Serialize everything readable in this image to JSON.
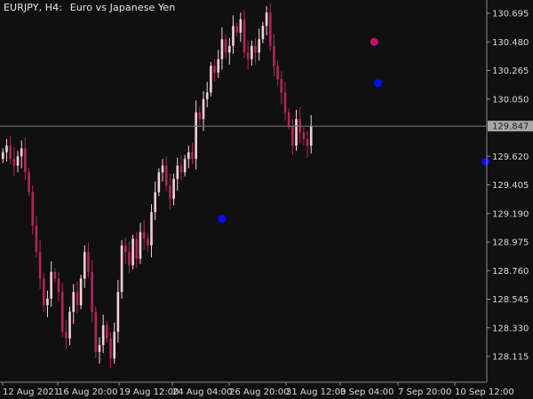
{
  "header": {
    "symbol_timeframe": "EURJPY, H4:",
    "description": "Euro vs Japanese Yen"
  },
  "colors": {
    "background": "#101010",
    "bull_candle": "#f6cfd6",
    "bear_candle": "#b0255e",
    "axis": "#8c8c8c",
    "axis_text": "#d9d9d9",
    "current_price_line": "#7a7a7a",
    "current_price_label_bg": "#a7a7a7",
    "signal_buy": "#0a0aff",
    "signal_sell": "#c0126c"
  },
  "chart_data": {
    "type": "candlestick",
    "symbol": "EURJPY",
    "timeframe": "H4",
    "ylim": [
      128.0,
      130.8
    ],
    "y_ticks": [
      "130.695",
      "130.480",
      "130.265",
      "130.050",
      "129.620",
      "129.405",
      "129.190",
      "128.975",
      "128.760",
      "128.545",
      "128.330",
      "128.115"
    ],
    "x_ticks": [
      "12 Aug 2021",
      "16 Aug 20:00",
      "19 Aug 12:00",
      "24 Aug 04:00",
      "26 Aug 20:00",
      "31 Aug 12:00",
      "3 Sep 04:00",
      "7 Sep 20:00",
      "10 Sep 12:00"
    ],
    "current_price": "129.847",
    "closes": [
      129.65,
      129.7,
      129.6,
      129.55,
      129.62,
      129.68,
      129.5,
      129.35,
      129.1,
      128.9,
      128.7,
      128.5,
      128.55,
      128.75,
      128.7,
      128.6,
      128.3,
      128.25,
      128.45,
      128.6,
      128.5,
      128.7,
      128.9,
      128.75,
      128.45,
      128.15,
      128.2,
      128.35,
      128.25,
      128.1,
      128.3,
      128.6,
      128.95,
      128.9,
      128.8,
      129.0,
      128.85,
      129.05,
      129.0,
      128.95,
      129.2,
      129.35,
      129.5,
      129.55,
      129.4,
      129.3,
      129.45,
      129.55,
      129.5,
      129.6,
      129.65,
      129.6,
      129.95,
      129.9,
      130.05,
      130.1,
      130.3,
      130.25,
      130.35,
      130.5,
      130.4,
      130.45,
      130.6,
      130.55,
      130.65,
      130.4,
      130.35,
      130.45,
      130.4,
      130.5,
      130.6,
      130.7,
      130.45,
      130.3,
      130.2,
      130.1,
      129.95,
      129.85,
      129.7,
      129.9,
      129.8,
      129.75,
      129.7,
      129.85
    ],
    "signals": [
      {
        "type": "buy",
        "index": 59,
        "price": 129.15
      },
      {
        "type": "sell",
        "index": 100,
        "price": 130.48
      },
      {
        "type": "buy",
        "index": 101,
        "price": 130.17
      },
      {
        "type": "buy",
        "index": 130,
        "price": 129.58
      }
    ]
  }
}
